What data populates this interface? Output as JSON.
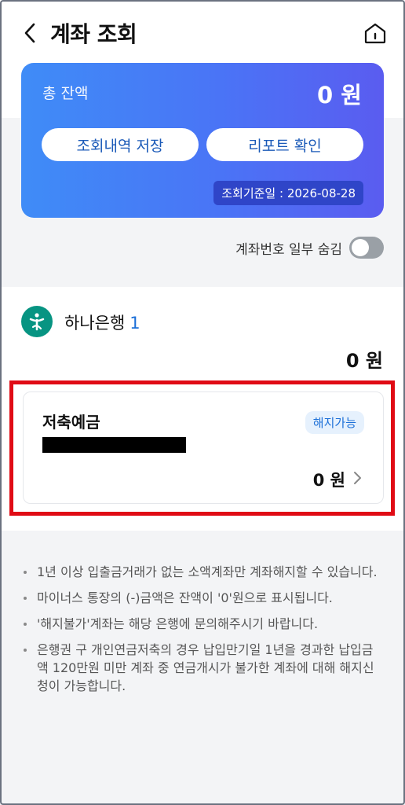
{
  "header": {
    "title": "계좌 조회",
    "back_icon": "chevron-left-icon",
    "home_icon": "home-icon"
  },
  "balance_card": {
    "total_label": "총 잔액",
    "total_amount": "0 원",
    "save_history_label": "조회내역 저장",
    "report_label": "리포트 확인",
    "reference_date": "조회기준일 : 2026-08-28",
    "gradient_start": "#3f8cf7",
    "gradient_end": "#5a5cf0"
  },
  "mask_toggle": {
    "label": "계좌번호 일부 숨김",
    "enabled": false
  },
  "bank": {
    "name": "하나은행",
    "account_count": "1",
    "total": "0 원",
    "logo_color": "#079482",
    "accounts": [
      {
        "name": "저축예금",
        "status": "해지가능",
        "amount": "0 원"
      }
    ]
  },
  "notices": [
    "1년 이상 입출금거래가 없는 소액계좌만 계좌해지할 수 있습니다.",
    "마이너스 통장의 (-)금액은 잔액이 '0'원으로 표시됩니다.",
    "'해지불가'계좌는 해당 은행에 문의해주시기 바랍니다.",
    "은행권 구 개인연금저축의 경우 납입만기일 1년을 경과한 납입금액 120만원 미만 계좌 중 연금개시가 불가한 계좌에 대해 해지신청이 가능합니다."
  ],
  "colors": {
    "accent": "#1b6fd8",
    "highlight": "#e00b15"
  }
}
